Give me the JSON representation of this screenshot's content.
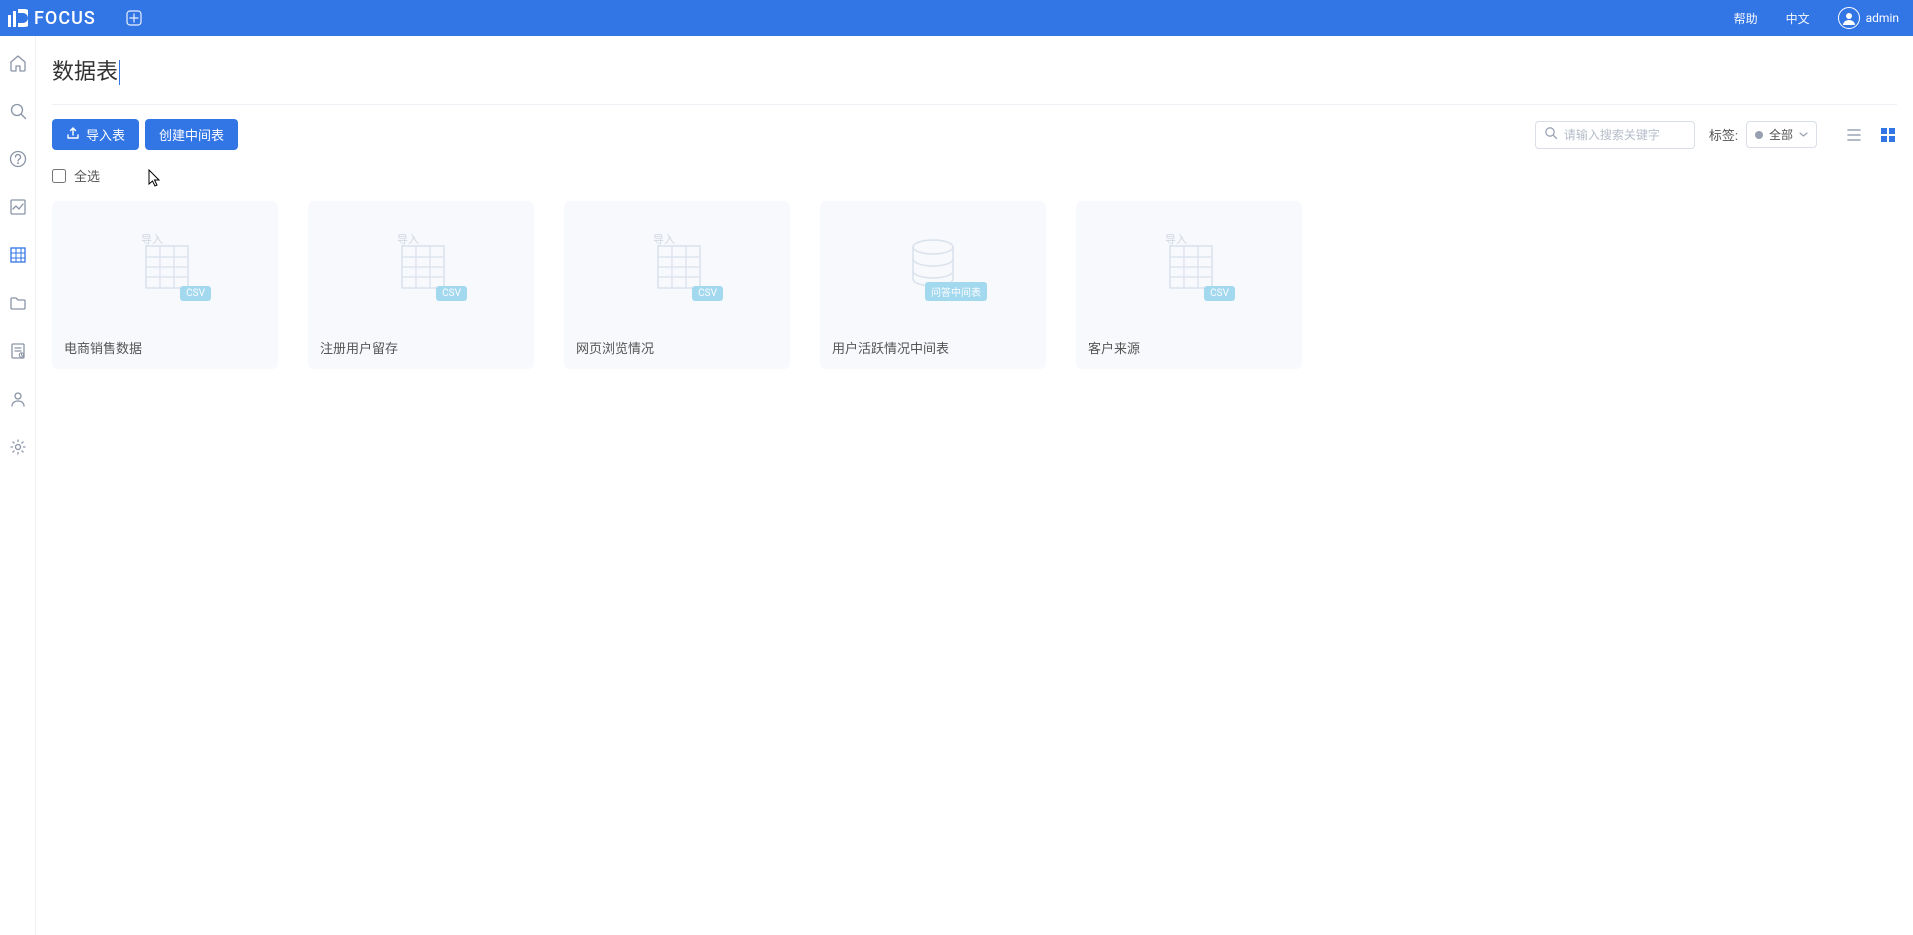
{
  "topbar": {
    "brand": "FOCUS",
    "help": "帮助",
    "lang": "中文",
    "user": "admin"
  },
  "page": {
    "title": "数据表"
  },
  "toolbar": {
    "import_label": "导入表",
    "create_label": "创建中间表",
    "search_placeholder": "请输入搜索关键字",
    "tag_label": "标签:",
    "tag_value": "全部"
  },
  "select_all": {
    "label": "全选"
  },
  "cards": [
    {
      "title": "电商销售数据",
      "type": "csv",
      "badge": "CSV",
      "import": "导入"
    },
    {
      "title": "注册用户留存",
      "type": "csv",
      "badge": "CSV",
      "import": "导入"
    },
    {
      "title": "网页浏览情况",
      "type": "csv",
      "badge": "CSV",
      "import": "导入"
    },
    {
      "title": "用户活跃情况中间表",
      "type": "db",
      "badge": "问答中间表",
      "import": ""
    },
    {
      "title": "客户来源",
      "type": "csv",
      "badge": "CSV",
      "import": "导入"
    }
  ]
}
